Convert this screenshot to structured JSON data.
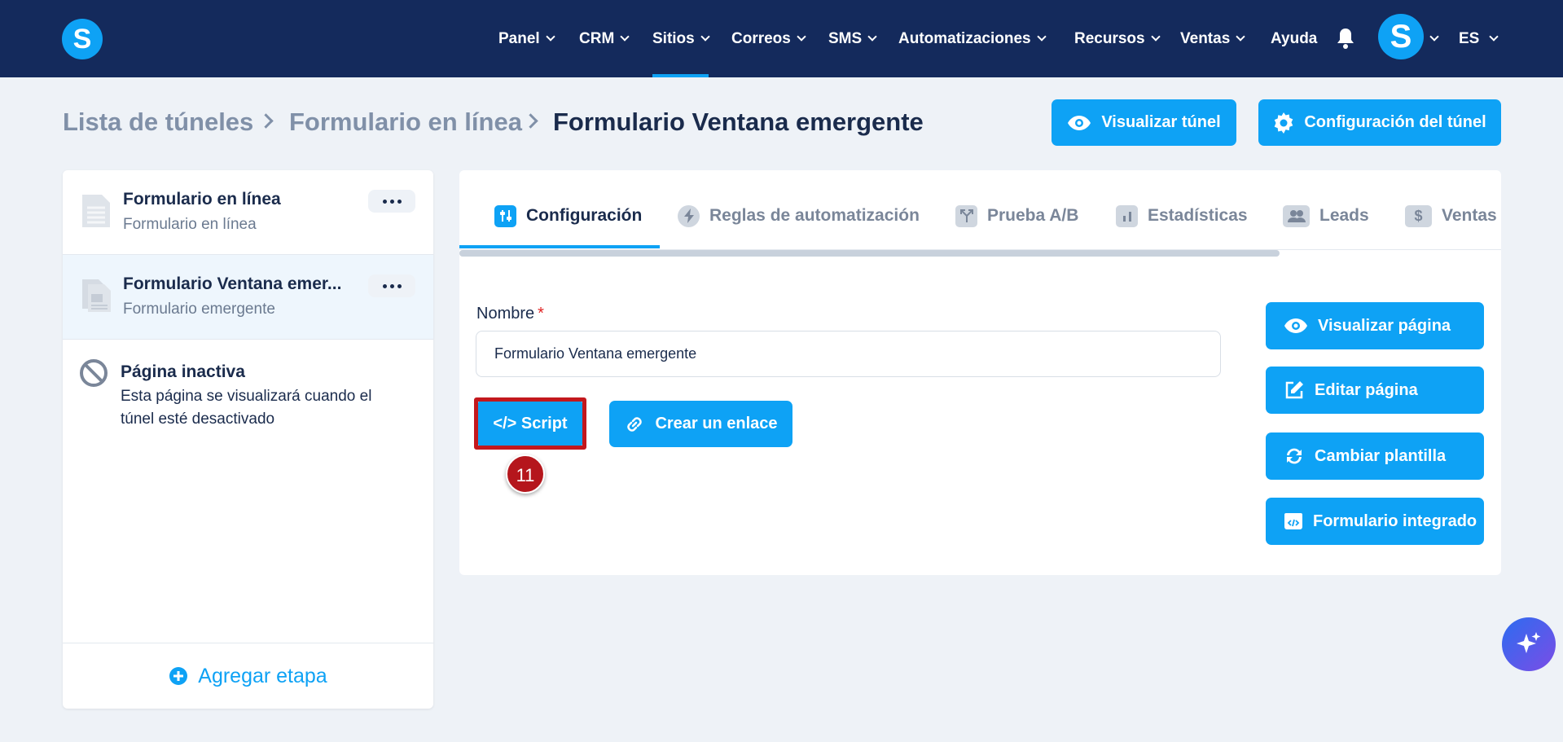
{
  "header": {
    "logo_letter": "S",
    "nav": [
      {
        "label": "Panel",
        "has_menu": true,
        "active": false
      },
      {
        "label": "CRM",
        "has_menu": true,
        "active": false
      },
      {
        "label": "Sitios",
        "has_menu": true,
        "active": true
      },
      {
        "label": "Correos",
        "has_menu": true,
        "active": false
      },
      {
        "label": "SMS",
        "has_menu": true,
        "active": false
      },
      {
        "label": "Automatizaciones",
        "has_menu": true,
        "active": false
      },
      {
        "label": "Recursos",
        "has_menu": true,
        "active": false
      },
      {
        "label": "Ventas",
        "has_menu": true,
        "active": false
      },
      {
        "label": "Ayuda",
        "has_menu": false,
        "active": false
      }
    ],
    "avatar_letter": "S",
    "language": "ES"
  },
  "breadcrumb": {
    "items": [
      "Lista de túneles",
      "Formulario en línea",
      "Formulario Ventana emergente"
    ]
  },
  "header_actions": {
    "preview_funnel": "Visualizar túnel",
    "funnel_settings": "Configuración del túnel"
  },
  "steps": [
    {
      "title": "Formulario en línea",
      "subtitle": "Formulario en línea",
      "selected": false
    },
    {
      "title": "Formulario Ventana emer...",
      "subtitle": "Formulario emergente",
      "selected": true
    }
  ],
  "inactive_page": {
    "title": "Página inactiva",
    "description": "Esta página se visualizará cuando el túnel esté desactivado"
  },
  "add_step": "Agregar etapa",
  "tabs": [
    {
      "label": "Configuración",
      "icon": "sliders-icon",
      "active": true
    },
    {
      "label": "Reglas de automatización",
      "icon": "bolt-icon",
      "active": false
    },
    {
      "label": "Prueba A/B",
      "icon": "split-icon",
      "active": false
    },
    {
      "label": "Estadísticas",
      "icon": "bar-chart-icon",
      "active": false
    },
    {
      "label": "Leads",
      "icon": "users-icon",
      "active": false
    },
    {
      "label": "Ventas",
      "icon": "dollar-icon",
      "active": false
    }
  ],
  "form": {
    "name_label": "Nombre",
    "required_mark": "*",
    "name_value": "Formulario Ventana emergente"
  },
  "actions": {
    "script": "</> Script",
    "create_link": "Crear un enlace"
  },
  "side_actions": [
    {
      "label": "Visualizar página",
      "icon": "eye-icon"
    },
    {
      "label": "Editar página",
      "icon": "edit-icon"
    },
    {
      "label": "Cambiar plantilla",
      "icon": "refresh-icon"
    },
    {
      "label": "Formulario integrado",
      "icon": "embed-icon"
    }
  ],
  "annotation": {
    "step_number": "11"
  },
  "colors": {
    "navbar": "#142a5c",
    "accent": "#0ea2f5",
    "highlight": "#c3181d"
  }
}
